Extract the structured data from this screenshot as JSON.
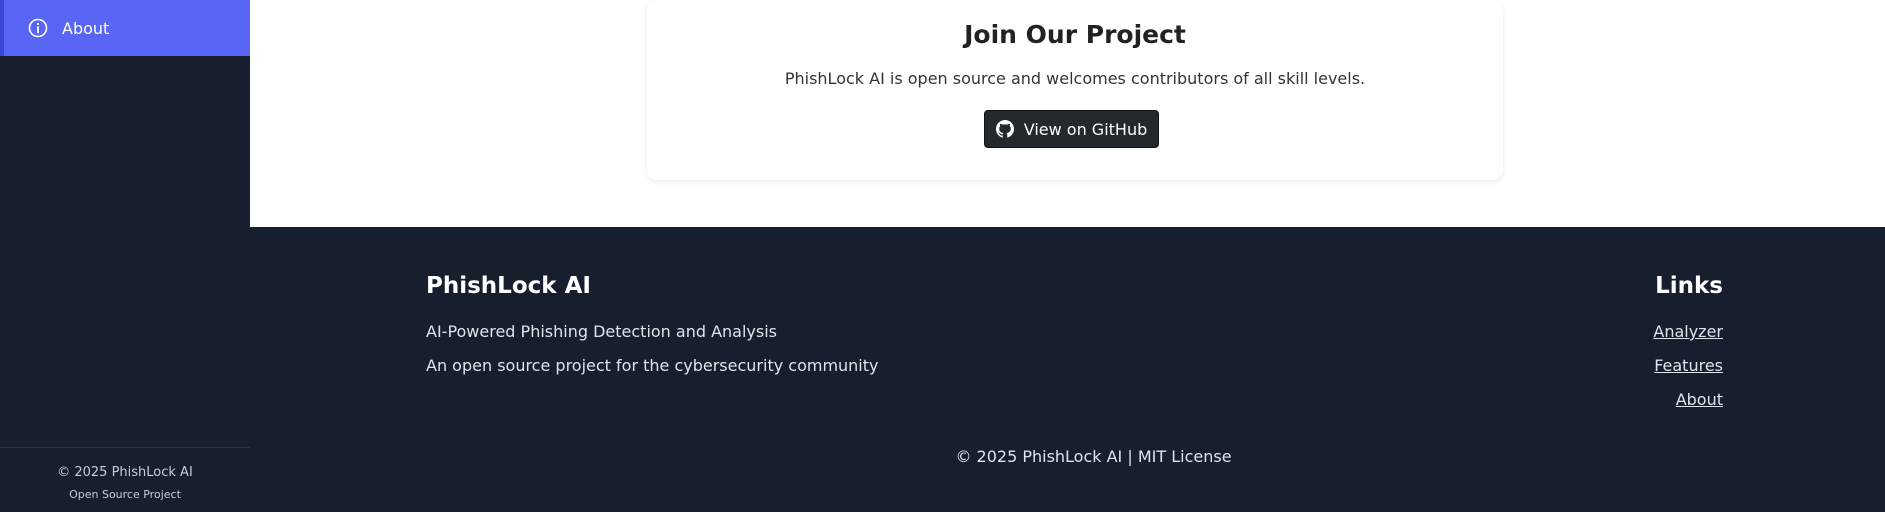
{
  "sidebar": {
    "active_item": {
      "label": "About",
      "icon": "info-icon"
    },
    "footer": {
      "copyright": "© 2025 PhishLock AI",
      "subtitle": "Open Source Project"
    }
  },
  "card": {
    "title": "Join Our Project",
    "text": "PhishLock AI is open source and welcomes contributors of all skill levels.",
    "button_label": "View on GitHub",
    "button_icon": "github-icon"
  },
  "footer": {
    "brand_title": "PhishLock AI",
    "brand_lines": [
      "AI-Powered Phishing Detection and Analysis",
      "An open source project for the cybersecurity community"
    ],
    "links_title": "Links",
    "links": [
      "Analyzer",
      "Features",
      "About"
    ],
    "copyright": "© 2025 PhishLock AI | MIT License"
  },
  "colors": {
    "sidebar_bg": "#171e2e",
    "accent": "#5865f5",
    "button_bg": "#24292e"
  }
}
